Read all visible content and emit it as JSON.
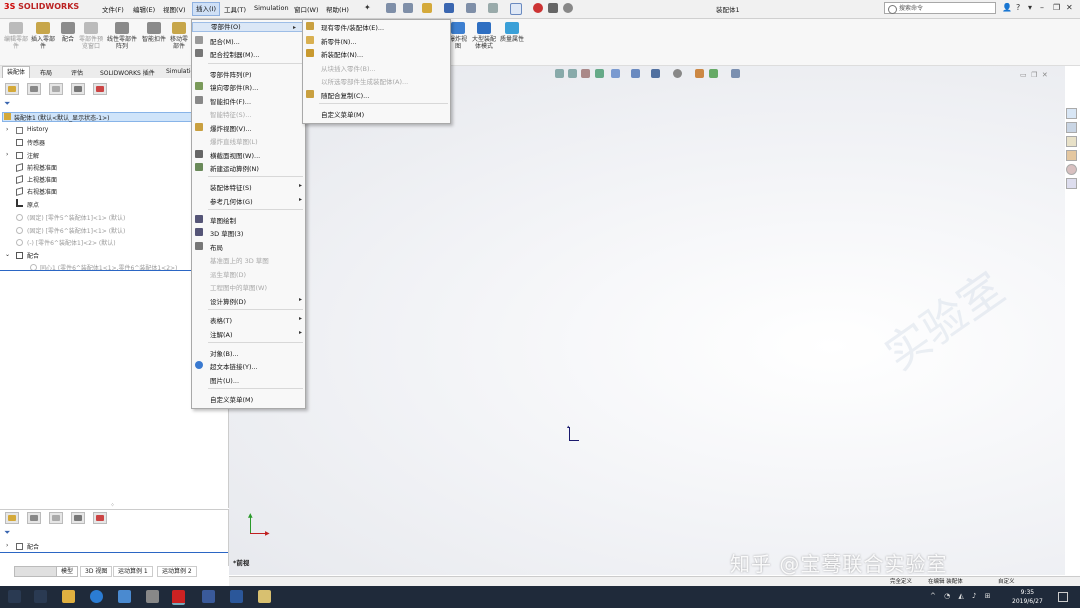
{
  "app": {
    "logo_text": "SOLIDWORKS",
    "logo_prefix": "3S",
    "document_title": "装配体1"
  },
  "menubar": [
    "文件(F)",
    "编辑(E)",
    "视图(V)",
    "插入(I)",
    "工具(T)",
    "Simulation",
    "窗口(W)",
    "帮助(H)"
  ],
  "search": {
    "placeholder": "搜索命令"
  },
  "ribbon": {
    "buttons": [
      "编辑零部件",
      "插入零部件",
      "配合",
      "零部件预览窗口",
      "线性零部件阵列",
      "智能扣件",
      "移动零部件"
    ],
    "right_buttons": [
      "爆炸视图",
      "大型装配体模式",
      "质量属性"
    ]
  },
  "feature_tabs": [
    "装配体",
    "布局",
    "评估",
    "SOLIDWORKS 插件",
    "Simulation"
  ],
  "tree": {
    "root": "装配体1 (默认<默认_显示状态-1>)",
    "items": [
      {
        "label": "History",
        "dim": false
      },
      {
        "label": "传感器",
        "dim": false
      },
      {
        "label": "注解",
        "dim": false
      },
      {
        "label": "前视基准面",
        "dim": false
      },
      {
        "label": "上视基准面",
        "dim": false
      },
      {
        "label": "右视基准面",
        "dim": false
      },
      {
        "label": "原点",
        "dim": false
      },
      {
        "label": "(固定) [零件5^装配体1]<1> (默认)",
        "dim": true
      },
      {
        "label": "(固定) [零件6^装配体1]<1> (默认)",
        "dim": true
      },
      {
        "label": "(-) [零件6^装配体1]<2> (默认)",
        "dim": true
      },
      {
        "label": "配合",
        "dim": false
      },
      {
        "label": "同心1 (零件6^装配体1<1>,零件6^装配体1<2>)",
        "dim": true
      }
    ]
  },
  "lower_panel": {
    "item": "配合"
  },
  "bottom_tabs": [
    "模型",
    "3D 视图",
    "运动算例 1",
    "运动算例 2"
  ],
  "insert_menu": {
    "items": [
      {
        "label": "零部件(O)",
        "arrow": true,
        "highlight": true
      },
      {
        "label": "配合(M)...",
        "icon": "mate-icon"
      },
      {
        "label": "配合控制器(M)...",
        "icon": "mate-controller-icon"
      },
      {
        "sep": true
      },
      {
        "label": "零部件阵列(P)",
        "arrow": true
      },
      {
        "label": "镜向零部件(R)...",
        "icon": "mirror-icon"
      },
      {
        "label": "智能扣件(F)...",
        "icon": "fastener-icon"
      },
      {
        "label": "智能特征(S)...",
        "dim": true
      },
      {
        "label": "爆炸视图(V)...",
        "icon": "explode-icon"
      },
      {
        "label": "爆炸直线草图(L)",
        "dim": true
      },
      {
        "label": "横截面视图(W)...",
        "icon": "section-icon"
      },
      {
        "label": "新建运动算例(N)",
        "icon": "motion-icon"
      },
      {
        "sep": true
      },
      {
        "label": "装配体特征(S)",
        "arrow": true
      },
      {
        "label": "参考几何体(G)",
        "arrow": true
      },
      {
        "sep": true
      },
      {
        "label": "草图绘制",
        "icon": "sketch-icon"
      },
      {
        "label": "3D 草图(3)",
        "icon": "sketch3d-icon"
      },
      {
        "label": "布局",
        "icon": "layout-icon"
      },
      {
        "label": "基准面上的 3D 草图",
        "dim": true
      },
      {
        "label": "派生草图(D)",
        "dim": true
      },
      {
        "label": "工程图中的草图(W)",
        "dim": true
      },
      {
        "label": "设计算例(D)",
        "arrow": true
      },
      {
        "sep": true
      },
      {
        "label": "表格(T)",
        "arrow": true
      },
      {
        "label": "注解(A)",
        "arrow": true
      },
      {
        "sep": true
      },
      {
        "label": "对象(B)...",
        "icon": ""
      },
      {
        "label": "超文本链接(Y)...",
        "icon": "hyperlink-icon"
      },
      {
        "label": "图片(U)...",
        "icon": ""
      },
      {
        "sep": true
      },
      {
        "label": "自定义菜单(M)"
      }
    ]
  },
  "component_submenu": {
    "items": [
      {
        "label": "现有零件/装配体(E)...",
        "icon": "existing-part-icon"
      },
      {
        "label": "新零件(N)...",
        "icon": "new-part-icon"
      },
      {
        "label": "新装配体(N)...",
        "icon": "new-assembly-icon"
      },
      {
        "label": "从块插入零件(B)...",
        "dim": true
      },
      {
        "label": "以所选零部件生成装配体(A)...",
        "dim": true
      },
      {
        "label": "随配合复制(C)...",
        "icon": "copy-with-mates-icon"
      },
      {
        "sep": true
      },
      {
        "label": "自定义菜单(M)"
      }
    ]
  },
  "viewport": {
    "view_label": "*前视"
  },
  "statusbar": [
    "完全定义",
    "在编辑 装配体",
    "自定义"
  ],
  "taskbar": {
    "time": "9:35",
    "date": "2019/6/27"
  },
  "watermark": "知乎 @宝蓦联合实验室",
  "colors": {
    "accent": "#c00000",
    "menu_highlight": "#dbe7f6",
    "selection": "#cfe4fa",
    "taskbar": "#1f2a3a"
  }
}
